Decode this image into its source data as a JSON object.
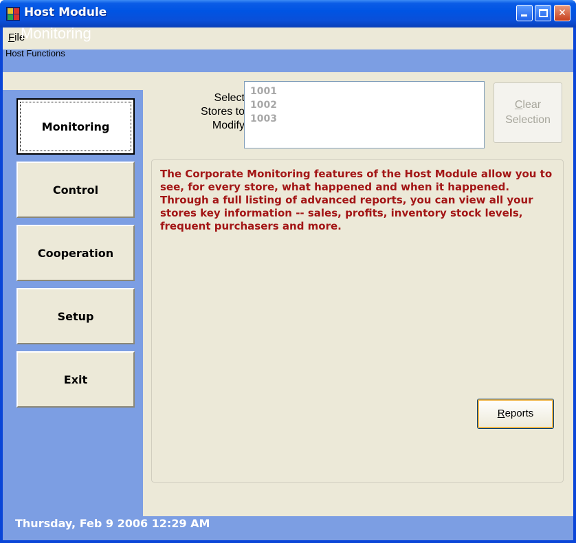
{
  "window": {
    "title": "Host Module",
    "min_glyph": "",
    "max_glyph": "",
    "close_glyph": "✕"
  },
  "menu": {
    "items": [
      {
        "label": "File",
        "mnemonic": "F"
      }
    ]
  },
  "header": {
    "section_title": "Monitoring"
  },
  "sidebar": {
    "group_label": "Host Functions",
    "buttons": [
      {
        "label": "Monitoring",
        "active": true
      },
      {
        "label": "Control",
        "active": false
      },
      {
        "label": "Cooperation",
        "active": false
      },
      {
        "label": "Setup",
        "active": false
      },
      {
        "label": "Exit",
        "active": false
      }
    ]
  },
  "stores": {
    "label_line1": "Select",
    "label_line2": "Stores to",
    "label_line3": "Modify",
    "items": [
      "1001",
      "1002",
      "1003"
    ],
    "clear_line1": "Clear",
    "clear_line2": "Selection",
    "clear_enabled": false
  },
  "description": {
    "text": "The Corporate Monitoring features of the Host Module allow you to see, for every store, what happened and when it happened. Through a full listing of advanced reports, you can view all your stores key information -- sales, profits, inventory stock levels, frequent purchasers and more."
  },
  "actions": {
    "reports_label": "Reports"
  },
  "status": {
    "datetime": "Thursday, Feb 9 2006 12:29 AM"
  },
  "colors": {
    "accent_blue": "#7c9ee3",
    "title_blue": "#0054e3",
    "description_red": "#a31616",
    "panel_beige": "#ece9d8"
  }
}
